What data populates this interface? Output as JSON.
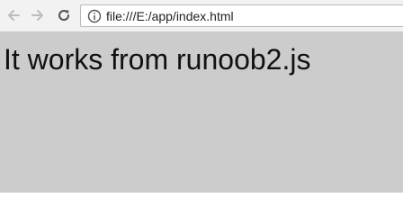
{
  "browser": {
    "address_bar": {
      "url": "file:///E:/app/index.html"
    },
    "buttons": {
      "back": "back-arrow-icon",
      "forward": "forward-arrow-icon",
      "reload": "reload-icon",
      "info": "info-icon"
    }
  },
  "page": {
    "body_text": "It works from runoob2.js",
    "background_color": "#cccccc"
  }
}
